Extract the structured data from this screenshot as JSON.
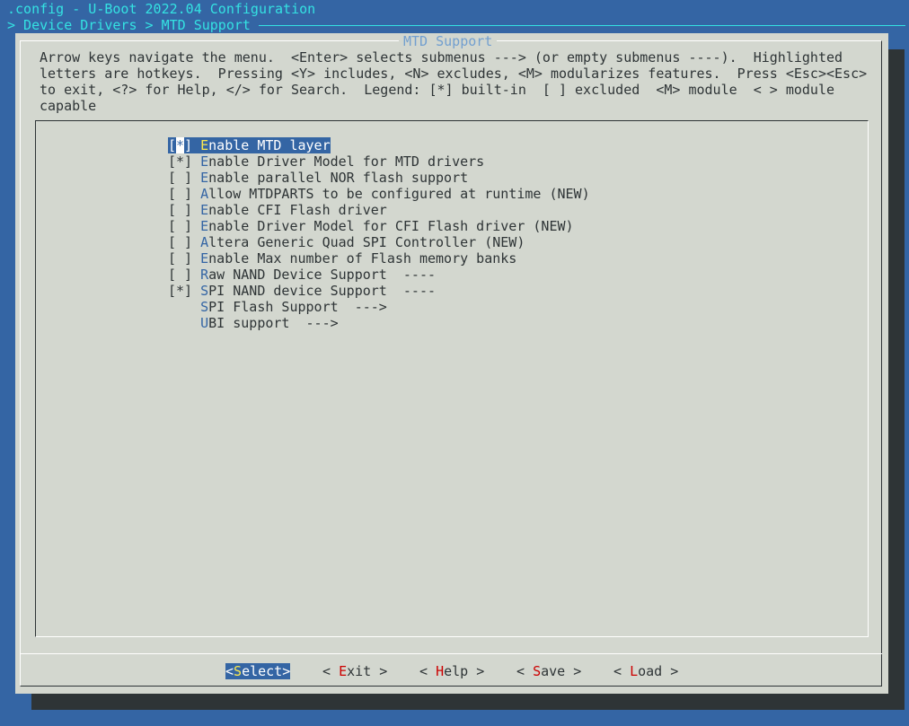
{
  "header": {
    "title": ".config - U-Boot 2022.04 Configuration",
    "breadcrumb": "> Device Drivers > MTD Support"
  },
  "dialog": {
    "title": "MTD Support",
    "help_lines": [
      "Arrow keys navigate the menu.  <Enter> selects submenus ---> (or empty submenus ----).  Highlighted",
      "letters are hotkeys.  Pressing <Y> includes, <N> excludes, <M> modularizes features.  Press <Esc><Esc>",
      "to exit, <?> for Help, </> for Search.  Legend: [*] built-in  [ ] excluded  <M> module  < > module",
      "capable"
    ]
  },
  "menu": {
    "items": [
      {
        "state": "[*]",
        "hotkey": "E",
        "rest": "nable MTD layer",
        "highlighted": true
      },
      {
        "state": "[*]",
        "hotkey": "E",
        "rest": "nable Driver Model for MTD drivers"
      },
      {
        "state": "[ ]",
        "hotkey": "E",
        "rest": "nable parallel NOR flash support"
      },
      {
        "state": "[ ]",
        "hotkey": "A",
        "rest": "llow MTDPARTS to be configured at runtime (NEW)"
      },
      {
        "state": "[ ]",
        "hotkey": "E",
        "rest": "nable CFI Flash driver"
      },
      {
        "state": "[ ]",
        "hotkey": "E",
        "rest": "nable Driver Model for CFI Flash driver (NEW)"
      },
      {
        "state": "[ ]",
        "hotkey": "A",
        "rest": "ltera Generic Quad SPI Controller (NEW)"
      },
      {
        "state": "[ ]",
        "hotkey": "E",
        "rest": "nable Max number of Flash memory banks"
      },
      {
        "state": "[ ]",
        "hotkey": "R",
        "rest": "aw NAND Device Support  ----"
      },
      {
        "state": "[*]",
        "hotkey": "S",
        "rest": "PI NAND device Support  ----"
      },
      {
        "state": "   ",
        "hotkey": "S",
        "rest": "PI Flash Support  --->"
      },
      {
        "state": "   ",
        "hotkey": "U",
        "rest": "BI support  --->"
      }
    ]
  },
  "buttons": {
    "select": {
      "pre": "<",
      "key": "S",
      "post": "elect>"
    },
    "exit": {
      "pre": "< ",
      "key": "E",
      "post": "xit >"
    },
    "help": {
      "pre": "< ",
      "key": "H",
      "post": "elp >"
    },
    "save": {
      "pre": "< ",
      "key": "S",
      "post": "ave >"
    },
    "load": {
      "pre": "< ",
      "key": "L",
      "post": "oad >"
    }
  },
  "colors": {
    "background": "#3465a4",
    "dialog": "#d3d7cf",
    "highlight": "#3465a4",
    "hotkey": "#3465a4",
    "button_hotkey": "#cc0000",
    "title": "#34e2e2"
  }
}
